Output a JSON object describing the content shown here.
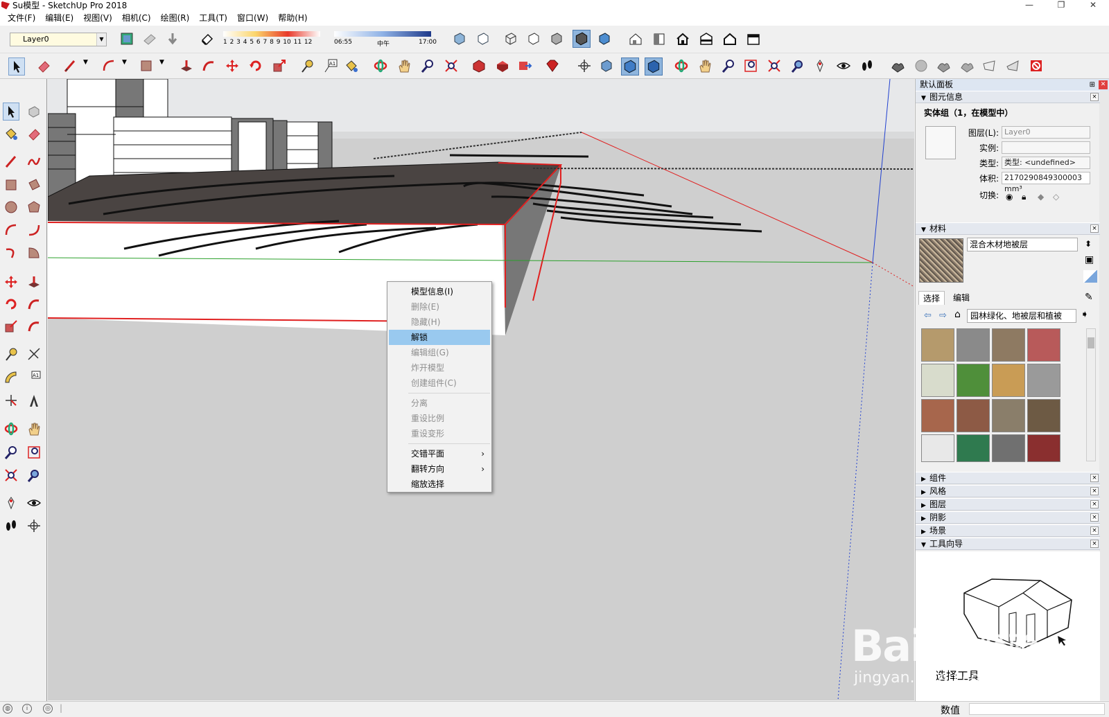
{
  "window": {
    "title": "Su模型 - SketchUp Pro 2018",
    "buttons": [
      "—",
      "❐",
      "✕"
    ]
  },
  "menubar": {
    "items": [
      "文件(F)",
      "编辑(E)",
      "视图(V)",
      "相机(C)",
      "绘图(R)",
      "工具(T)",
      "窗口(W)",
      "帮助(H)"
    ]
  },
  "toolbar": {
    "layer": "Layer0",
    "shadow_months": "1 2 3 4 5 6 7 8 9 10 11 12",
    "time_start": "06:55",
    "time_mid": "中午",
    "time_end": "17:00"
  },
  "context_menu": {
    "items": [
      {
        "label": "模型信息(I)",
        "state": "enabled"
      },
      {
        "label": "删除(E)",
        "state": "disabled"
      },
      {
        "label": "隐藏(H)",
        "state": "disabled"
      },
      {
        "label": "解锁",
        "state": "active"
      },
      {
        "label": "编辑组(G)",
        "state": "disabled"
      },
      {
        "label": "炸开模型",
        "state": "disabled"
      },
      {
        "label": "创建组件(C)",
        "state": "disabled"
      },
      {
        "label": "分离",
        "state": "disabled"
      },
      {
        "label": "重设比例",
        "state": "disabled"
      },
      {
        "label": "重设变形",
        "state": "disabled"
      },
      {
        "label": "交错平面",
        "state": "enabled",
        "submenu": true
      },
      {
        "label": "翻转方向",
        "state": "enabled",
        "submenu": true
      },
      {
        "label": "缩放选择",
        "state": "enabled"
      }
    ],
    "submenu_glyph": "›"
  },
  "tray": {
    "title": "默认面板",
    "pin": "⊞",
    "close": "✕",
    "entity_info": {
      "section": "图元信息",
      "heading": "实体组（1，在模型中）",
      "layer_label": "图层(L):",
      "layer_value": "Layer0",
      "instance_label": "实例:",
      "instance_value": "",
      "type_label": "类型:",
      "type_value": "类型: <undefined>",
      "volume_label": "体积:",
      "volume_value": "2170290849300003 mm³",
      "toggle_label": "切换:"
    },
    "materials": {
      "section": "材料",
      "name": "混合木材地被层",
      "tab_select": "选择",
      "tab_edit": "编辑",
      "library": "园林绿化、地被层和植被",
      "swatch_colors": [
        "#b59a6c",
        "#8a8a8a",
        "#8e7a62",
        "#b85a5a",
        "#d8dccc",
        "#4f8f3a",
        "#c99c55",
        "#9a9a9a",
        "#a7664c",
        "#8d5a45",
        "#8a7e6a",
        "#6d5a44",
        "#e8e8e8",
        "#2f7a4f",
        "#707070",
        "#8a2f2f"
      ]
    },
    "collapsed_sections": [
      "组件",
      "风格",
      "图层",
      "阴影",
      "场景"
    ],
    "instructor": {
      "section": "工具向导",
      "title": "选择工具"
    }
  },
  "statusbar": {
    "value_label": "数值",
    "value": ""
  },
  "watermark": {
    "brand": "Bai",
    "du": "du",
    "jing": "经验",
    "url": "jingyan.baidu.com"
  }
}
